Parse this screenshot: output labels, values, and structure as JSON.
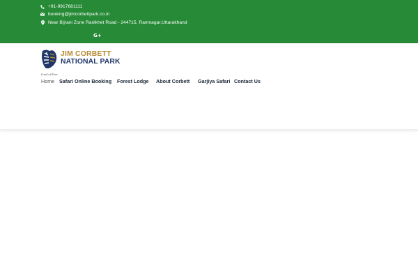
{
  "topbar": {
    "phone": "+91-9917681111",
    "email": "booking@jimcorbettpark.co.in",
    "address": "Near Bijrani Zone Ranikhet Road - 244715, Ramnagar,Uttarakhand",
    "social_icon": "google-plus-icon",
    "social_label": "G+",
    "bg_color": "#268a36"
  },
  "logo": {
    "line1": "JIM CORBETT",
    "line2": "NATIONAL PARK",
    "tagline": "Land of Roar",
    "line1_color": "#b48a2e",
    "line2_color": "#1f3667"
  },
  "nav": {
    "items": [
      {
        "label": "Home",
        "active": true
      },
      {
        "label": "Safari Online Booking",
        "active": false
      },
      {
        "label": "Forest Lodge",
        "active": false
      },
      {
        "label": "About Corbett",
        "active": false
      },
      {
        "label": "Garjiya Safari",
        "active": false
      },
      {
        "label": "Contact Us",
        "active": false
      }
    ]
  }
}
